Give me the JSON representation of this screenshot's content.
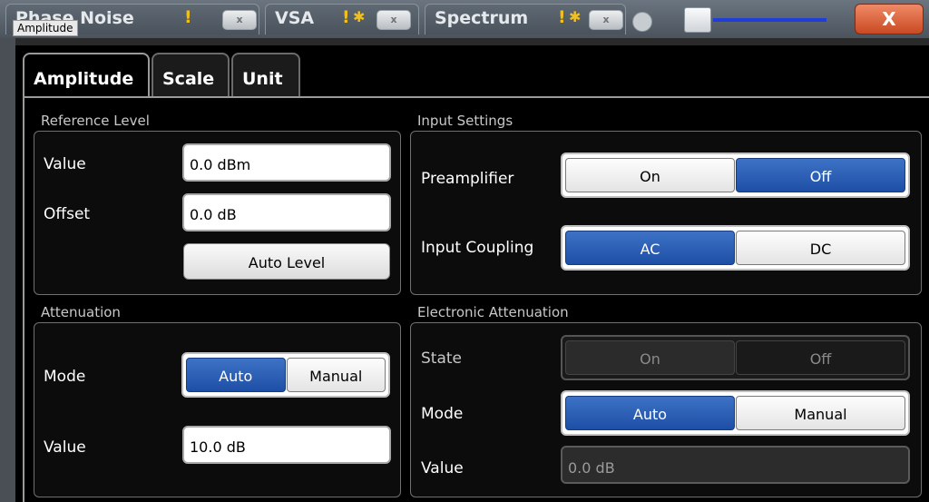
{
  "channel_bar": {
    "tabs": [
      {
        "label": "Phase Noise",
        "warn": "!",
        "close": "x"
      },
      {
        "label": "VSA",
        "warn": "!",
        "star": "✱",
        "close": "x"
      },
      {
        "label": "Spectrum",
        "warn": "!",
        "star": "✱",
        "close": "x"
      }
    ],
    "close_window": "X"
  },
  "dialog": {
    "title": "Amplitude",
    "tabs": [
      "Amplitude",
      "Scale",
      "Unit"
    ],
    "active_tab": "Amplitude"
  },
  "reference_level": {
    "title": "Reference Level",
    "value_label": "Value",
    "value": "0.0 dBm",
    "offset_label": "Offset",
    "offset": "0.0 dB",
    "auto_level_label": "Auto Level"
  },
  "input_settings": {
    "title": "Input Settings",
    "preamplifier_label": "Preamplifier",
    "preamplifier_options": [
      "On",
      "Off"
    ],
    "preamplifier_selected": "Off",
    "input_coupling_label": "Input Coupling",
    "input_coupling_options": [
      "AC",
      "DC"
    ],
    "input_coupling_selected": "AC"
  },
  "attenuation": {
    "title": "Attenuation",
    "mode_label": "Mode",
    "mode_options": [
      "Auto",
      "Manual"
    ],
    "mode_selected": "Auto",
    "value_label": "Value",
    "value": "10.0 dB"
  },
  "electronic_attenuation": {
    "title": "Electronic Attenuation",
    "state_label": "State",
    "state_options": [
      "On",
      "Off"
    ],
    "state_selected": "Off",
    "mode_label": "Mode",
    "mode_options": [
      "Auto",
      "Manual"
    ],
    "mode_selected": "Auto",
    "value_label": "Value",
    "value": "0.0 dB"
  },
  "colors": {
    "selected_blue": "#2a5db8",
    "background": "#000000",
    "close_button": "#d85a30"
  }
}
